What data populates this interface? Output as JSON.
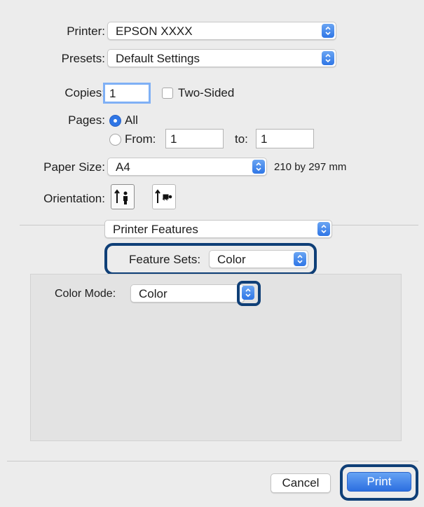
{
  "printer": {
    "label": "Printer:",
    "value": "EPSON XXXX"
  },
  "presets": {
    "label": "Presets:",
    "value": "Default Settings"
  },
  "copies": {
    "label": "Copies:",
    "value": "1",
    "two_sided_label": "Two-Sided"
  },
  "pages": {
    "label": "Pages:",
    "all_label": "All",
    "from_label": "From:",
    "from_value": "1",
    "to_label": "to:",
    "to_value": "1"
  },
  "paper_size": {
    "label": "Paper Size:",
    "value": "A4",
    "dimensions": "210 by 297 mm"
  },
  "orientation": {
    "label": "Orientation:",
    "selected": "portrait",
    "options": [
      "portrait-icon",
      "landscape-icon"
    ]
  },
  "section": {
    "value": "Printer Features"
  },
  "feature_sets": {
    "label": "Feature Sets:",
    "value": "Color"
  },
  "color_mode": {
    "label": "Color Mode:",
    "value": "Color"
  },
  "buttons": {
    "cancel": "Cancel",
    "print": "Print"
  },
  "colors": {
    "accent": "#2f76e6",
    "highlight": "#0f3f77",
    "background": "#ececec"
  }
}
